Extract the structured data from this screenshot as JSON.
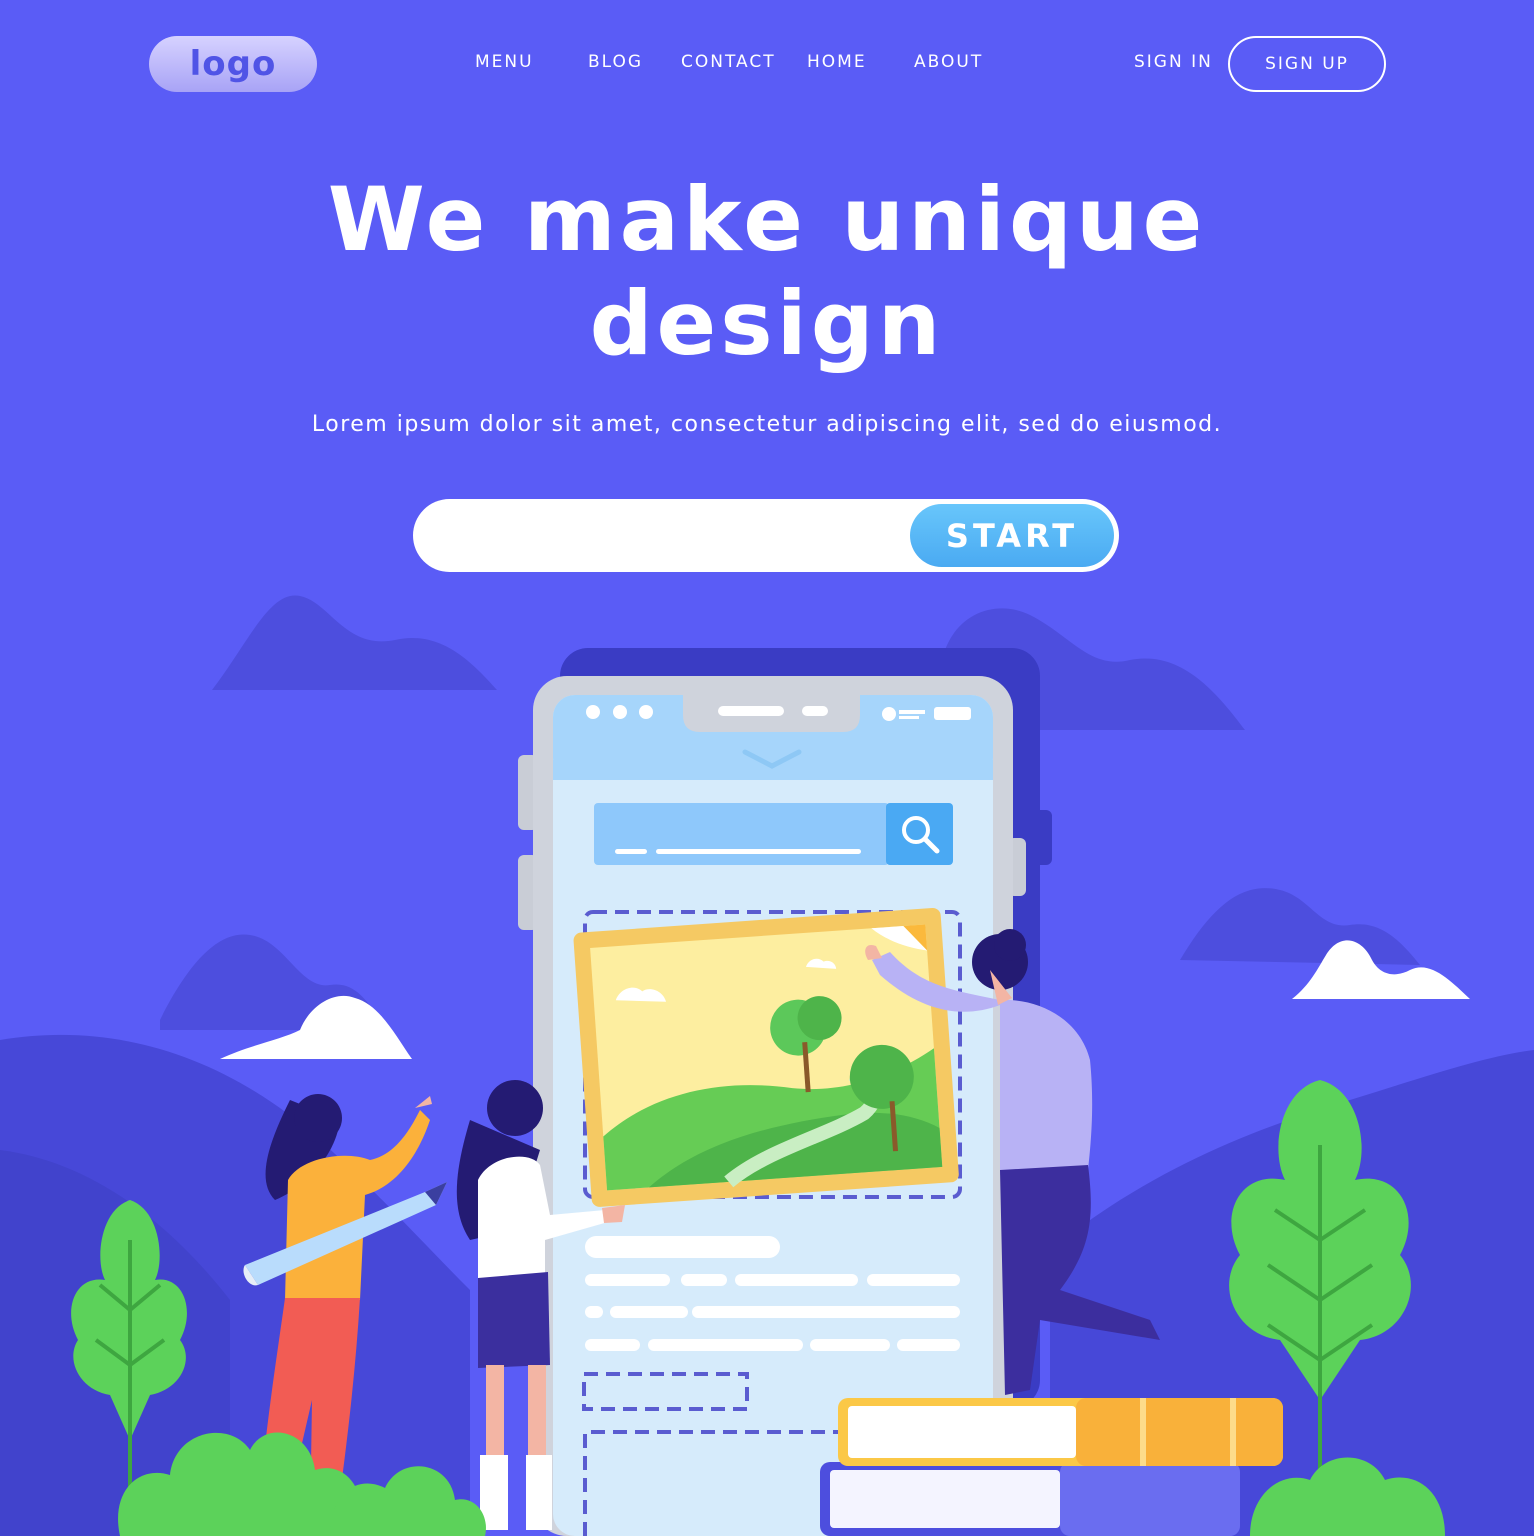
{
  "nav": {
    "logo": "logo",
    "links": [
      "MENU",
      "BLOG",
      "CONTACT",
      "HOME",
      "ABOUT"
    ],
    "sign_in": "SIGN IN",
    "sign_up": "SIGN UP"
  },
  "hero": {
    "headline_line1": "We make unique",
    "headline_line2": "design",
    "subtitle": "Lorem ipsum dolor sit amet, consectetur adipiscing elit, sed do eiusmod.",
    "search_value": "",
    "start_label": "START"
  },
  "colors": {
    "background": "#5a5cf6",
    "accent": "#4aaaf2",
    "plant_green": "#5cd25a"
  },
  "icons": [
    "search-icon",
    "cloud",
    "tree",
    "phone-mockup",
    "picture-frame",
    "books",
    "pencil"
  ]
}
